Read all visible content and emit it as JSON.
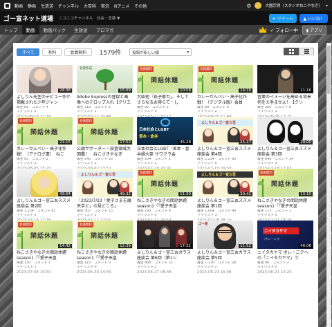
{
  "topbar": {
    "nav": [
      "動画",
      "静画",
      "生放送",
      "チャンネル",
      "大百科",
      "実況",
      "Nアニメ",
      "その他"
    ],
    "user_name": "大園宗賀（スタジオねこやなぎ）"
  },
  "channel": {
    "title": "ゴー宣ネット道場",
    "subtitle": "ニコニコチャンネル　社会・言論 ▼",
    "tweet_label": "ツイート",
    "like_label": "いいね！",
    "tabs": [
      "トップ",
      "動画",
      "動画パック",
      "生放送",
      "ブロマガ"
    ],
    "active_tab": "動画",
    "follow_label": "フォロー中",
    "app_label": "アプリ"
  },
  "filters": {
    "all": "すべて",
    "paid": "有料",
    "members_free": "会員無料",
    "count": "1579件",
    "sort": "投稿が新しい順"
  },
  "videos": [
    {
      "title": "よしりん先生のデビュー作が掲載された少年ジャン",
      "meta1": "再生 85　コメント 4",
      "meta2": "マイリスト 2",
      "date": "2023-08-16 21:16",
      "duration": "24:38",
      "thumb": "anime"
    },
    {
      "title": "Adobe Expressの登録と画像へのテロップ入れ【クリエ",
      "meta1": "再生 315　コメント 2",
      "meta2": "マイリスト 1",
      "date": "2023-03-12 20:48",
      "duration": "15:09",
      "thumb": "tree"
    },
    {
      "title": "大紘他「長子敬カ」、そしてさらなるお得らて・し",
      "meta1": "再生 95　コメント 2",
      "meta2": "マイリスト 0",
      "date": "2023-05-11 13:12",
      "duration": "10:58",
      "thumb": "sleep"
    },
    {
      "title": "カレーせんべい・高子化作戦！（デジタル版）会員",
      "meta1": "再生 80　コメント 6",
      "meta2": "マイリスト 2",
      "date": "2023-08-05 11:49",
      "duration": "14:16",
      "thumb": "sleep"
    },
    {
      "title": "営業のイメージを高める背景何をえ手ませよ！【クリ",
      "meta1": "再生 200　コメント 6",
      "meta2": "マイリスト 1",
      "date": "2023-08-06 13:25",
      "duration": "11:16",
      "thumb": "dark"
    },
    {
      "title": "カレーせんべい・高子化作戦！（アナログ書）　ねこ",
      "meta1": "再生 85　コメント 2",
      "meta2": "マイリスト 2",
      "date": "2023-08-05 15:20",
      "duration": "21:15",
      "thumb": "sleep"
    },
    {
      "title": "公論サポーター・設置領域大図鑑！　ねこさきやなぎ",
      "meta1": "再生 240　コメント 16",
      "meta2": "マイリスト 2",
      "date": "2023-08-02 13:52",
      "duration": "17:52",
      "thumb": "sleep"
    },
    {
      "title": "日本社会とLGBT「差本・倉井縁大臣 サワクラ会",
      "meta1": "再生 204　コメント 2",
      "meta2": "マイリスト 1",
      "date": "2023-07-19 20:01",
      "duration": "45:28",
      "thumb": "news"
    },
    {
      "title": "よしりん＆ゴー宣三吾スズメ 座談会 第4回",
      "meta1": "再生 1,234　コメント 80",
      "meta2": "マイリスト 5",
      "date": "2023-07-19 09:50",
      "duration": "25:37",
      "thumb": "cartoon"
    },
    {
      "title": "よしりん＆ゴー宣三吾スズメ 座談会 第3回",
      "meta1": "再生 840　コメント 34",
      "meta2": "マイリスト 3",
      "date": "2023-07-18 17:03",
      "duration": "29:00",
      "thumb": "kaonashi"
    },
    {
      "title": "よしりん＆ゴー宣三吾スズメ 座談会 第2回",
      "meta1": "再生 1,234　コメント 81",
      "meta2": "マイリスト 3",
      "date": "2023-07-16 17:35",
      "duration": "43:04",
      "thumb": "blonde"
    },
    {
      "title": "「2023/7/23「愛子さまを論天手ビ」の見どころ」",
      "meta1": "再生 507　コメント 13",
      "meta2": "マイリスト 2",
      "date": "2023-07-12 22:01",
      "duration": "49:32",
      "thumb": "cartoon"
    },
    {
      "title": "ねこさきやなぎの間話休題 season1「『愛子天皇",
      "meta1": "再生 290　コメント 9",
      "meta2": "マイリスト 0",
      "date": "2023-07-11 20:57",
      "duration": "11:30",
      "thumb": "sleep"
    },
    {
      "title": "よしりん＆ゴー宣三吾スズメ 座談会 第1回",
      "meta1": "再生 1,004　コメント 40",
      "meta2": "マイリスト 3",
      "date": "2023-07-08 08:10",
      "duration": "30:41",
      "thumb": "cartoondark"
    },
    {
      "title": "ねこさきやなぎの間話休題 season1「『愛子天皇",
      "meta1": "再生 175　コメント 3",
      "meta2": "マイリスト 0",
      "date": "2023-07-07 18:26",
      "duration": "13:10",
      "thumb": "sleep"
    },
    {
      "title": "ねこさきやなぎの間話休題 season1「『愛子天皇",
      "meta1": "再生 130　コメント 3",
      "meta2": "マイリスト 1",
      "date": "2023-07-04 16:50",
      "duration": "14:42",
      "thumb": "sleep"
    },
    {
      "title": "ねこさきやなぎの間話休題 season1「『愛子天皇",
      "meta1": "再生 115　コメント 0",
      "meta2": "マイリスト 0",
      "date": "2023-06-30 14:55",
      "duration": "12:39",
      "thumb": "sleep"
    },
    {
      "title": "よしりん＆ゴー宣三吾ガラス 座談会 第6回（第1シ",
      "meta1": "再生 888　コメント 32",
      "meta2": "マイリスト 2",
      "date": "2023-06-27 08:48",
      "duration": "17:31",
      "thumb": "talk"
    },
    {
      "title": "よしりん＆ゴー宣三吾ガラス 座談会 第5回",
      "meta1": "再生 1,176　コメント 26",
      "meta2": "マイリスト 2",
      "date": "2023-06-23 16:08",
      "duration": "11:52",
      "thumb": "glasses"
    },
    {
      "title": "ニイタカヤマ ボレー二クへの「ニイタカヤマ」う",
      "meta1": "再生 80　コメント 2",
      "meta2": "マイリスト 0",
      "date": "2023-06-21 10:20",
      "duration": "40:06",
      "thumb": "blue"
    }
  ],
  "thumb_text": {
    "badge": "会員無料",
    "sleep_big": "閑話休題",
    "tree_cap": "背景作成",
    "news_l1": "日本社会とLGBT",
    "news_l2": "差本・倉井",
    "cartoon_title": "よしりん＆ゴー宣三吾",
    "glasses_cap": "ゴー宣",
    "blue_banner": "ニイタカヤマ",
    "blue_sub": "ボレーニク"
  }
}
